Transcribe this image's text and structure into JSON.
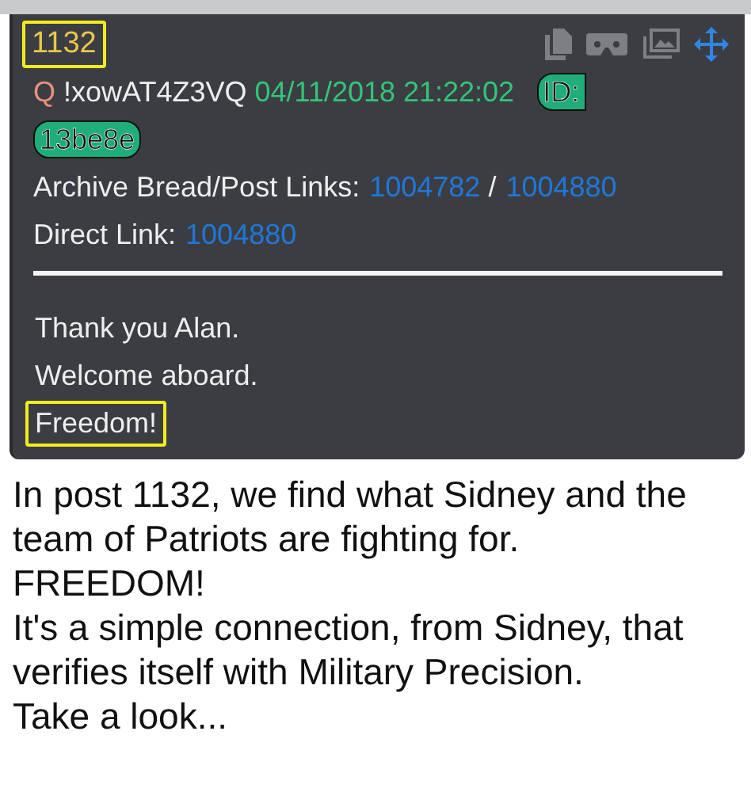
{
  "post": {
    "number": {
      "text": "1132",
      "highlighted": true
    },
    "author": "Q",
    "tripcode": "!xowAT4Z3VQ",
    "timestamp": "04/11/2018 21:22:02",
    "id_label": "ID:",
    "id_value": "13be8e",
    "archive": {
      "label": "Archive Bread/Post Links:",
      "links": [
        "1004782",
        "1004880"
      ],
      "separator": "/"
    },
    "direct": {
      "label": "Direct Link:",
      "link": "1004880"
    },
    "body": [
      {
        "text": "Thank you Alan.",
        "highlighted": false
      },
      {
        "text": "Welcome aboard.",
        "highlighted": false
      },
      {
        "text": "Freedom!",
        "highlighted": true
      }
    ]
  },
  "caption": [
    "In post 1132, we find what Sidney and the team of Patriots are fighting for.",
    "FREEDOM!",
    "It's a simple connection, from Sidney, that verifies itself with Military Precision.",
    "Take a look..."
  ]
}
